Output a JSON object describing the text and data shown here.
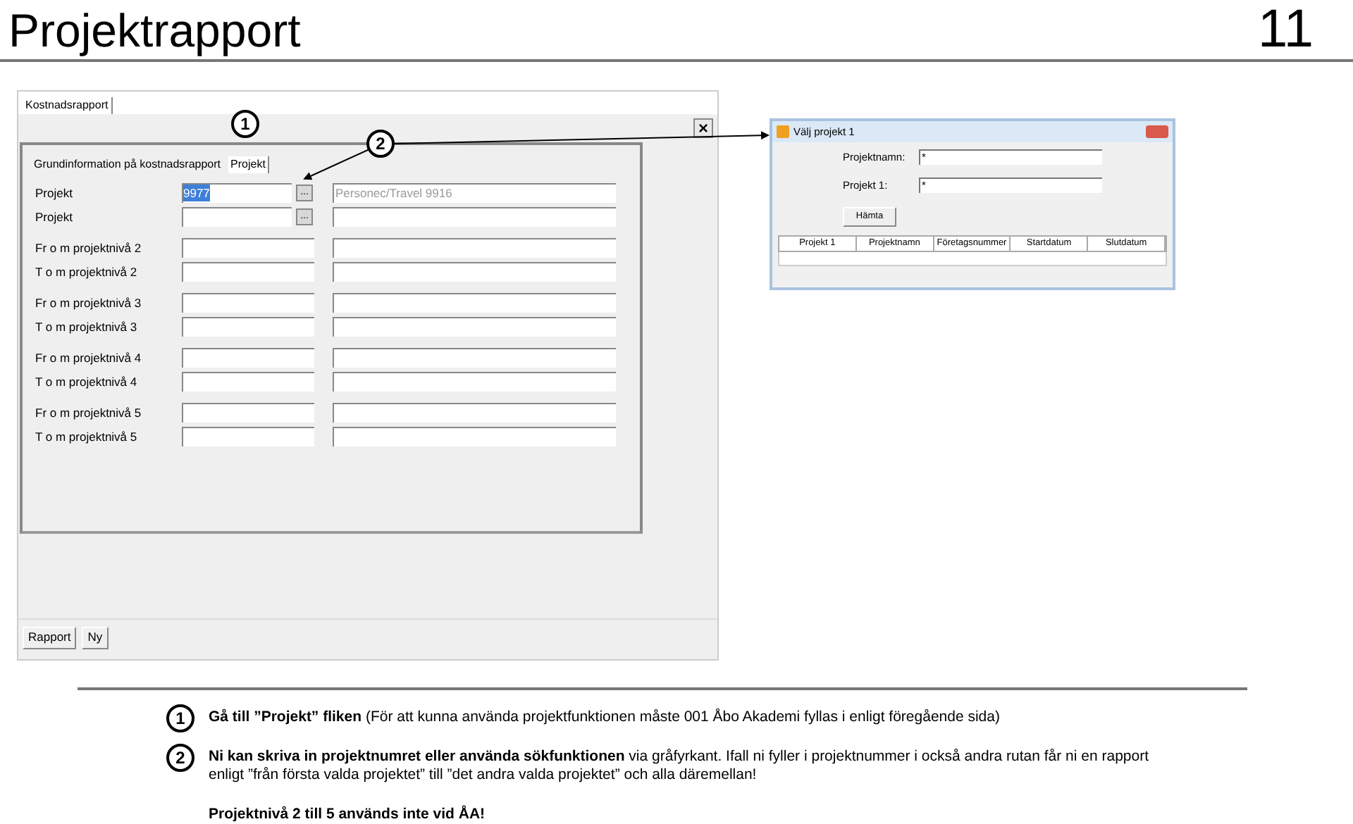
{
  "page": {
    "title": "Projektrapport",
    "number": "11"
  },
  "app": {
    "window_tab": "Kostnadsrapport",
    "tabs": [
      {
        "label": "Grundinformation på kostnadsrapport",
        "selected": false
      },
      {
        "label": "Projekt",
        "selected": true
      }
    ],
    "rows": [
      {
        "label": "Projekt",
        "value": "9977",
        "value_selected": true,
        "lookup": true,
        "name": "Personec/Travel 9916"
      },
      {
        "label": "Projekt",
        "lookup": true
      },
      {
        "label": "Fr o m projektnivå 2",
        "lookup": false
      },
      {
        "label": "T o m projektnivå 2",
        "lookup": false
      },
      {
        "label": "Fr o m projektnivå 3",
        "lookup": false
      },
      {
        "label": "T o m projektnivå 3",
        "lookup": false
      },
      {
        "label": "Fr o m projektnivå 4",
        "lookup": false
      },
      {
        "label": "T o m projektnivå 4",
        "lookup": false
      },
      {
        "label": "Fr o m projektnivå 5",
        "lookup": false
      },
      {
        "label": "T o m projektnivå 5",
        "lookup": false
      }
    ],
    "lookup_label": "...",
    "close": "×",
    "buttons": [
      "Rapport",
      "Ny"
    ]
  },
  "dialog": {
    "title": "Välj projekt 1",
    "fields": [
      {
        "label": "Projektnamn:",
        "value": "*"
      },
      {
        "label": "Projekt 1:",
        "value": "*"
      }
    ],
    "button": "Hämta",
    "columns": [
      "Projekt 1",
      "Projektnamn",
      "Företagsnummer",
      "Startdatum",
      "Slutdatum"
    ]
  },
  "callouts": [
    "1",
    "2"
  ],
  "notes": [
    {
      "number": "1",
      "lines": [
        "**Gå till ”Projekt” fliken** (För att kunna använda projektfunktionen måste 001 Åbo Akademi fyllas i enligt föregående sida)"
      ]
    },
    {
      "number": "2",
      "lines": [
        "**Ni kan skriva in projektnumret eller använda sökfunktionen** via gråfyrkant. Ifall ni fyller i projektnummer i också andra rutan får ni en rapport",
        "enligt ”från första valda projektet” till ”det andra valda projektet” och alla däremellan!"
      ]
    }
  ],
  "footer_note": "Projektnivå 2 till 5 används inte vid ÅA!"
}
